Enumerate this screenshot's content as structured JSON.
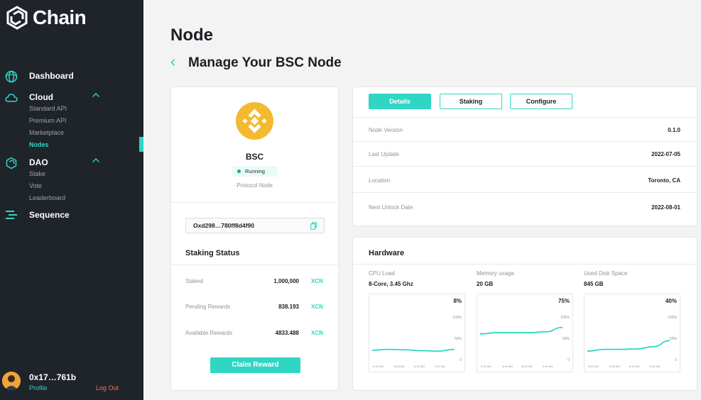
{
  "app": {
    "name": "Chain",
    "accent": "#2fd6c4"
  },
  "sidebar": {
    "groups": [
      {
        "label": "Dashboard",
        "icon": "globe-icon",
        "items": []
      },
      {
        "label": "Cloud",
        "icon": "cloud-icon",
        "items": [
          "Standard API",
          "Premium API",
          "Marketplace",
          "Nodes"
        ]
      },
      {
        "label": "DAO",
        "icon": "dao-icon",
        "items": [
          "Stake",
          "Vote",
          "Leaderboard"
        ]
      },
      {
        "label": "Sequence",
        "icon": "sequence-icon",
        "items": []
      }
    ],
    "active_item": "Nodes",
    "user": {
      "address": "0x17…761b",
      "profile_label": "Profile",
      "logout_label": "Log Out"
    }
  },
  "page": {
    "title": "Node",
    "subtitle": "Manage Your BSC Node"
  },
  "node": {
    "name": "BSC",
    "status": "Running",
    "type": "Protocol Node",
    "address": "Oxd298…780ff8d4f90"
  },
  "staking": {
    "title": "Staking Status",
    "rows": [
      {
        "label": "Staked",
        "value": "1,000,000",
        "currency": "XCN"
      },
      {
        "label": "Pending Rewards",
        "value": "838.193",
        "currency": "XCN"
      },
      {
        "label": "Available Rewards",
        "value": "4833.488",
        "currency": "XCN"
      }
    ],
    "claim_label": "Claim Reward"
  },
  "tabs": [
    {
      "label": "Details",
      "active": true
    },
    {
      "label": "Staking",
      "active": false
    },
    {
      "label": "Configure",
      "active": false
    }
  ],
  "details": [
    {
      "label": "Node Version",
      "value": "0.1.0"
    },
    {
      "label": "Last Update",
      "value": "2022-07-05"
    },
    {
      "label": "Location",
      "value": "Toronto, CA"
    },
    {
      "label": "Next Unlock Date",
      "value": "2022-08-01"
    }
  ],
  "hardware": {
    "title": "Hardware",
    "metrics": [
      {
        "label": "CPU Load",
        "value": "8-Core, 3.45 Ghz",
        "percent": "8%",
        "curve": [
          0.18,
          0.2,
          0.19,
          0.17,
          0.16,
          0.2
        ]
      },
      {
        "label": "Memory usage",
        "value": "20 GB",
        "percent": "75%",
        "curve": [
          0.55,
          0.58,
          0.58,
          0.58,
          0.6,
          0.7
        ]
      },
      {
        "label": "Used Disk Space",
        "value": "845 GB",
        "percent": "40%",
        "curve": [
          0.16,
          0.2,
          0.2,
          0.21,
          0.26,
          0.4
        ]
      }
    ],
    "ticks": [
      "100%",
      "50%",
      "0"
    ],
    "times": [
      "5:20 AM",
      "8:40 AM",
      "8:20 AM",
      "9:40 AM"
    ]
  }
}
